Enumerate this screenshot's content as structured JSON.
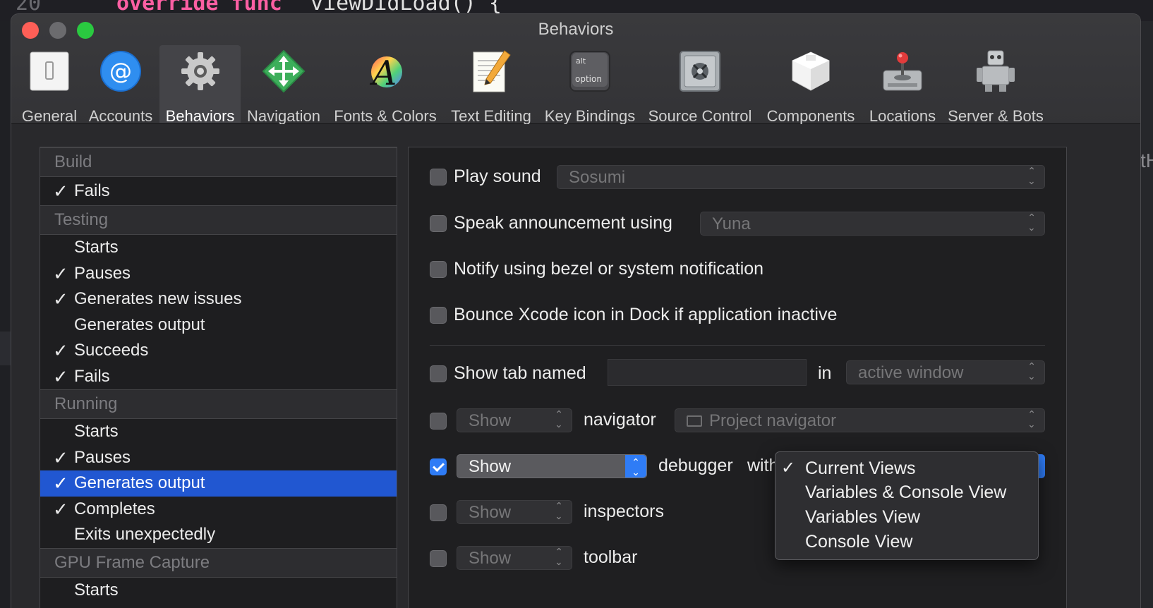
{
  "editor": {
    "line_number": "20",
    "keywords": "override func",
    "code": "viewDidLoad() {",
    "right_fragment": "tH"
  },
  "window": {
    "title": "Behaviors"
  },
  "toolbar": {
    "tabs": [
      {
        "label": "General",
        "icon": "general-icon"
      },
      {
        "label": "Accounts",
        "icon": "at-sign-icon"
      },
      {
        "label": "Behaviors",
        "icon": "gear-icon",
        "selected": true
      },
      {
        "label": "Navigation",
        "icon": "arrows-move-icon"
      },
      {
        "label": "Fonts & Colors",
        "icon": "font-palette-icon"
      },
      {
        "label": "Text Editing",
        "icon": "pencil-paper-icon"
      },
      {
        "label": "Key Bindings",
        "icon": "keyboard-key-icon"
      },
      {
        "label": "Source Control",
        "icon": "vault-icon"
      },
      {
        "label": "Components",
        "icon": "cube-icon"
      },
      {
        "label": "Locations",
        "icon": "joystick-drive-icon"
      },
      {
        "label": "Server & Bots",
        "icon": "robot-icon"
      }
    ],
    "key_icon_top": "alt",
    "key_icon_bottom": "option"
  },
  "events": {
    "build": {
      "header": "Build",
      "items": [
        {
          "label": "Fails",
          "checked": true
        }
      ]
    },
    "testing": {
      "header": "Testing",
      "items": [
        {
          "label": "Starts",
          "checked": false
        },
        {
          "label": "Pauses",
          "checked": true
        },
        {
          "label": "Generates new issues",
          "checked": true
        },
        {
          "label": "Generates output",
          "checked": false
        },
        {
          "label": "Succeeds",
          "checked": true
        },
        {
          "label": "Fails",
          "checked": true
        }
      ]
    },
    "running": {
      "header": "Running",
      "items": [
        {
          "label": "Starts",
          "checked": false
        },
        {
          "label": "Pauses",
          "checked": true
        },
        {
          "label": "Generates output",
          "checked": true,
          "selected": true
        },
        {
          "label": "Completes",
          "checked": true
        },
        {
          "label": "Exits unexpectedly",
          "checked": false
        }
      ]
    },
    "gpu": {
      "header": "GPU Frame Capture",
      "items": [
        {
          "label": "Starts",
          "checked": false
        }
      ]
    },
    "check_glyph": "✓"
  },
  "actions": {
    "play_sound": {
      "label": "Play sound",
      "checked": false,
      "value": "Sosumi"
    },
    "speak": {
      "label": "Speak announcement using",
      "checked": false,
      "value": "Yuna"
    },
    "notify": {
      "label": "Notify using bezel or system notification",
      "checked": false
    },
    "bounce": {
      "label": "Bounce Xcode icon in Dock if application inactive",
      "checked": false
    },
    "show_tab": {
      "label": "Show tab named",
      "checked": false,
      "value": "",
      "in_label": "in",
      "window_value": "active window"
    },
    "navigator": {
      "checked": false,
      "mode": "Show",
      "label": "navigator",
      "value": "Project navigator"
    },
    "debugger": {
      "checked": true,
      "mode": "Show",
      "label": "debugger",
      "with_label": "with"
    },
    "inspectors": {
      "checked": false,
      "mode": "Show",
      "label": "inspectors"
    },
    "toolbar": {
      "checked": false,
      "mode": "Show",
      "label": "toolbar"
    }
  },
  "debugger_menu": {
    "items": [
      {
        "label": "Current Views",
        "checked": true
      },
      {
        "label": "Variables & Console View",
        "checked": false
      },
      {
        "label": "Variables View",
        "checked": false
      },
      {
        "label": "Console View",
        "checked": false
      }
    ]
  },
  "colors": {
    "selection": "#2157d1",
    "accent": "#2f7cf6",
    "close": "#fe5f57",
    "maximize": "#2ac940"
  }
}
